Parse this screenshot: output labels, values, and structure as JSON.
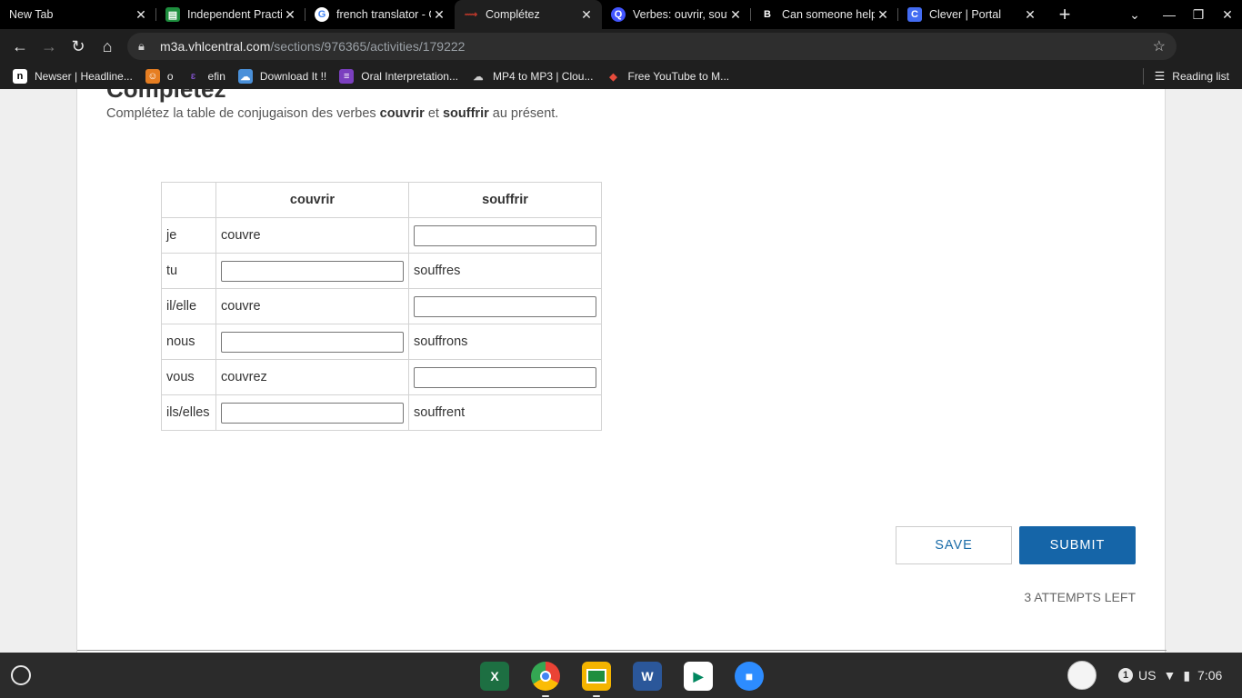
{
  "browser": {
    "tabs": [
      {
        "title": "New Tab",
        "icon": "none",
        "color": "",
        "active": false
      },
      {
        "title": "Independent Practice",
        "icon": "google-classroom-icon",
        "color": "#1e8e3e",
        "active": false
      },
      {
        "title": "french translator - Google Search",
        "icon": "google-icon",
        "color": "#ffffff",
        "active": false
      },
      {
        "title": "Complétez",
        "icon": "vhl-icon",
        "color": "#c0392b",
        "active": true
      },
      {
        "title": "Verbes: ouvrir, souffrir",
        "icon": "quizlet-icon",
        "color": "#4255ff",
        "active": false
      },
      {
        "title": "Can someone help",
        "icon": "brainly-icon",
        "color": "#000000",
        "active": false
      },
      {
        "title": "Clever | Portal",
        "icon": "clever-icon",
        "color": "#436cf2",
        "active": false
      }
    ],
    "url": {
      "host": "m3a.vhlcentral.com",
      "path": "/sections/976365/activities/179222"
    },
    "bookmarks": [
      {
        "label": "Newser | Headline...",
        "icon": "newser-icon",
        "glyph": "n",
        "color": "#000000"
      },
      {
        "label": "o",
        "icon": "person-icon",
        "glyph": "▪",
        "color": "#e67e22"
      },
      {
        "label": "efin",
        "icon": "efin-icon",
        "glyph": "ɛ",
        "color": "#5b2c83"
      },
      {
        "label": "Download It !!",
        "icon": "cloud-icon",
        "glyph": "☁",
        "color": "#4a90d9"
      },
      {
        "label": "Oral Interpretation...",
        "icon": "list-icon",
        "glyph": "≡",
        "color": "#7b3fbf"
      },
      {
        "label": "MP4 to MP3 | Clou...",
        "icon": "cloudconvert-icon",
        "glyph": "☁",
        "color": "#555555"
      },
      {
        "label": "Free YouTube to M...",
        "icon": "ytmp3-icon",
        "glyph": "◆",
        "color": "#e74c3c"
      }
    ],
    "reading_list": "Reading list"
  },
  "activity": {
    "title": "Complétez",
    "instructions_pre": "Complétez la table de conjugaison des verbes ",
    "verb1": "couvrir",
    "instructions_mid": " et ",
    "verb2": "souffrir",
    "instructions_post": " au présent.",
    "table": {
      "headers": [
        "",
        "couvrir",
        "souffrir"
      ],
      "rows": [
        {
          "pronoun": "je",
          "couvrir": "couvre",
          "souffrir": null
        },
        {
          "pronoun": "tu",
          "couvrir": null,
          "souffrir": "souffres"
        },
        {
          "pronoun": "il/elle",
          "couvrir": "couvre",
          "souffrir": null
        },
        {
          "pronoun": "nous",
          "couvrir": null,
          "souffrir": "souffrons"
        },
        {
          "pronoun": "vous",
          "couvrir": "couvrez",
          "souffrir": null
        },
        {
          "pronoun": "ils/elles",
          "couvrir": null,
          "souffrir": "souffrent"
        }
      ]
    },
    "save_label": "SAVE",
    "submit_label": "SUBMIT",
    "attempts_left": "3 ATTEMPTS LEFT"
  },
  "shelf": {
    "apps": [
      {
        "name": "excel-icon",
        "glyph": "X",
        "color": "#1d6f42",
        "running": false
      },
      {
        "name": "chrome-icon",
        "glyph": "",
        "color": "#4285f4",
        "running": true
      },
      {
        "name": "google-classroom-icon",
        "glyph": "",
        "color": "#f4b400",
        "running": true
      },
      {
        "name": "word-icon",
        "glyph": "W",
        "color": "#2b579a",
        "running": false
      },
      {
        "name": "play-store-icon",
        "glyph": "▶",
        "color": "#01875f",
        "running": false
      },
      {
        "name": "zoom-icon",
        "glyph": "▶",
        "color": "#2d8cff",
        "running": false
      }
    ],
    "notification_count": "1",
    "keyboard": "US",
    "time": "7:06"
  }
}
